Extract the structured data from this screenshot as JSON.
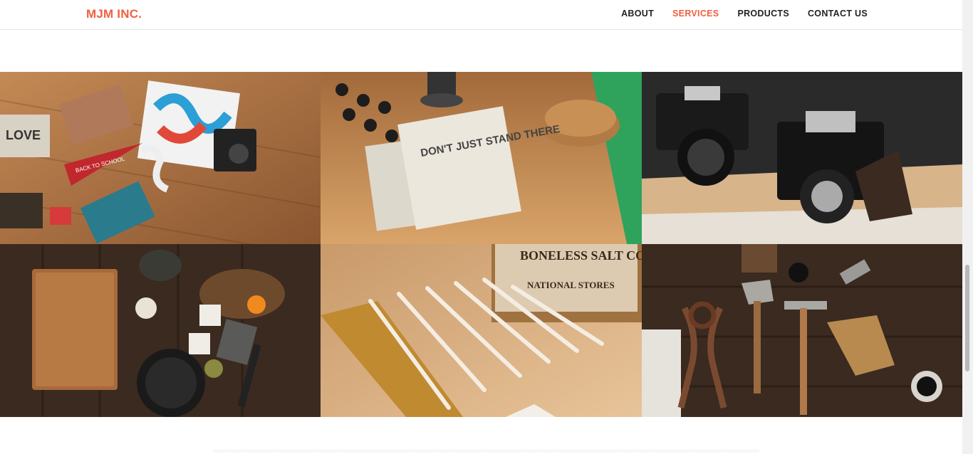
{
  "brand": {
    "name": "MJM INC.",
    "color": "#f05f40"
  },
  "nav": {
    "items": [
      {
        "label": "ABOUT",
        "active": false
      },
      {
        "label": "SERVICES",
        "active": true
      },
      {
        "label": "PRODUCTS",
        "active": false
      },
      {
        "label": "CONTACT US",
        "active": false
      }
    ]
  },
  "portfolio": {
    "tiles": [
      {
        "name": "portfolio-tile-flatlay",
        "label_a": "LOVE",
        "label_b": "BACK TO SCHOOL"
      },
      {
        "name": "portfolio-tile-notebooks",
        "label_a": "DON'T JUST STAND THERE"
      },
      {
        "name": "portfolio-tile-cameras"
      },
      {
        "name": "portfolio-tile-kitchen"
      },
      {
        "name": "portfolio-tile-rulers",
        "label_a": "BONELESS SALT CODFISH",
        "label_b": "NATIONAL STORES"
      },
      {
        "name": "portfolio-tile-tools"
      }
    ]
  }
}
